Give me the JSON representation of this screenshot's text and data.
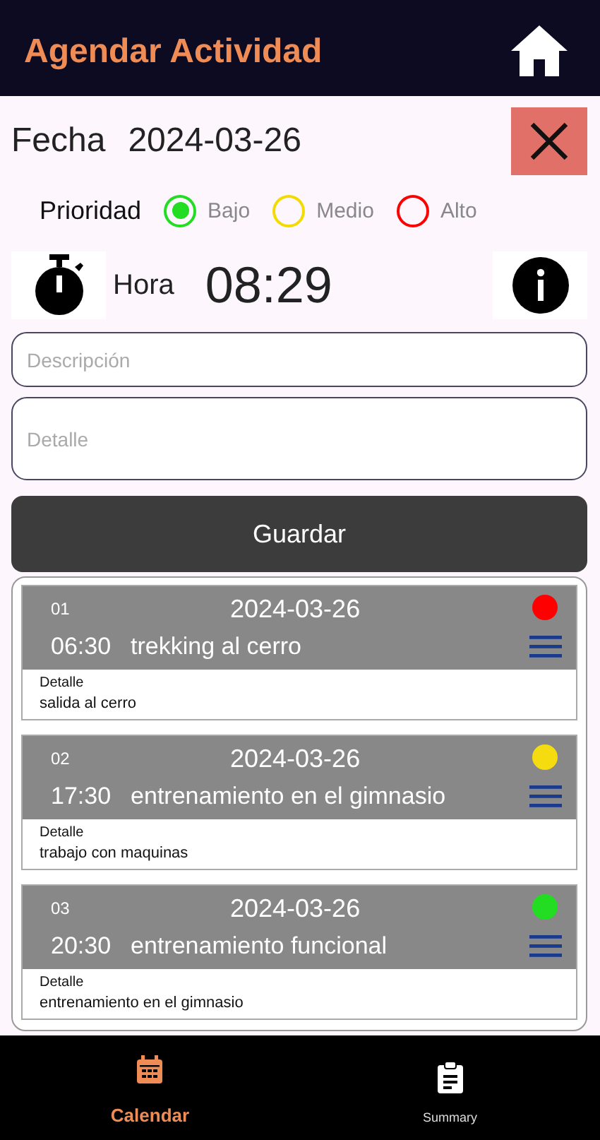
{
  "app_bar": {
    "title": "Agendar Actividad"
  },
  "form": {
    "date_label": "Fecha",
    "date": "2024-03-26",
    "priority_label": "Prioridad",
    "priorities": [
      {
        "label": "Bajo",
        "color": "#22dd22",
        "selected": true
      },
      {
        "label": "Medio",
        "color": "#f2dc00",
        "selected": false
      },
      {
        "label": "Alto",
        "color": "#ff0000",
        "selected": false
      }
    ],
    "time_label": "Hora",
    "time": "08:29",
    "description": {
      "placeholder": "Descripción"
    },
    "detail": {
      "placeholder": "Detalle"
    },
    "save_button": "Guardar"
  },
  "activities": [
    {
      "number": "01",
      "date": "2024-03-26",
      "time": "06:30",
      "title": "trekking al cerro",
      "detail_label": "Detalle",
      "detail": "salida al cerro",
      "color": "#ff0000"
    },
    {
      "number": "02",
      "date": "2024-03-26",
      "time": "17:30",
      "title": "entrenamiento en el gimnasio",
      "detail_label": "Detalle",
      "detail": "trabajo con maquinas",
      "color": "#f5dc10"
    },
    {
      "number": "03",
      "date": "2024-03-26",
      "time": "20:30",
      "title": "entrenamiento funcional",
      "detail_label": "Detalle",
      "detail": "entrenamiento en el gimnasio",
      "color": "#22dd22"
    }
  ],
  "bottom_nav": [
    {
      "label": "Calendar",
      "kind": "calendar",
      "selected": true
    },
    {
      "label": "Summary",
      "kind": "summary",
      "selected": false
    }
  ]
}
